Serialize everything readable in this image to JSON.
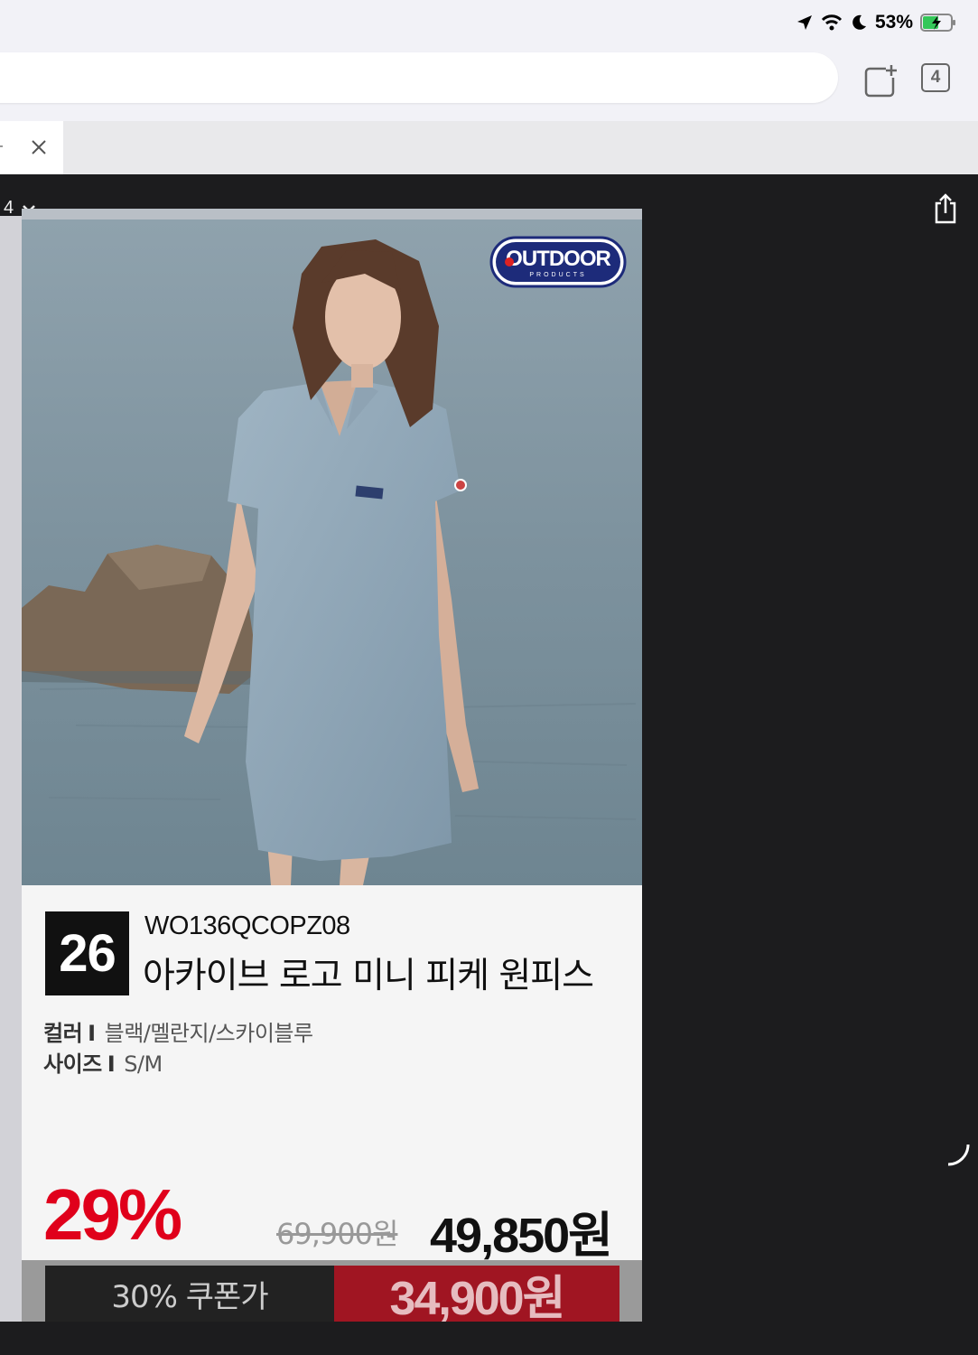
{
  "status_bar": {
    "battery_percent": "53%"
  },
  "tabs": {
    "open_count": "4"
  },
  "viewer": {
    "page_indicator": "4"
  },
  "product": {
    "brand": "OUTDOOR",
    "brand_sub": "PRODUCTS",
    "number": "26",
    "code": "WO136QCOPZ08",
    "name": "아카이브 로고 미니 피케 원피스",
    "color_label": "컬러",
    "color_separator": "I",
    "color_value": "블랙/멜란지/스카이블루",
    "size_label": "사이즈",
    "size_separator": "I",
    "size_value": "S/M",
    "discount_rate": "29%",
    "original_price": "69,900원",
    "sale_price": "49,850원",
    "coupon_label": "30% 쿠폰가",
    "coupon_price": "34,900원"
  },
  "colors": {
    "discount_red": "#e0001b",
    "coupon_red": "#a01522",
    "dress_blue": "#8ea6b8",
    "water": "#7a8e9a"
  },
  "icons": [
    "location-arrow-icon",
    "wifi-icon",
    "moon-icon",
    "battery-charging-icon",
    "new-tab-icon",
    "tab-count-icon",
    "close-icon",
    "chevron-down-icon",
    "share-icon"
  ]
}
